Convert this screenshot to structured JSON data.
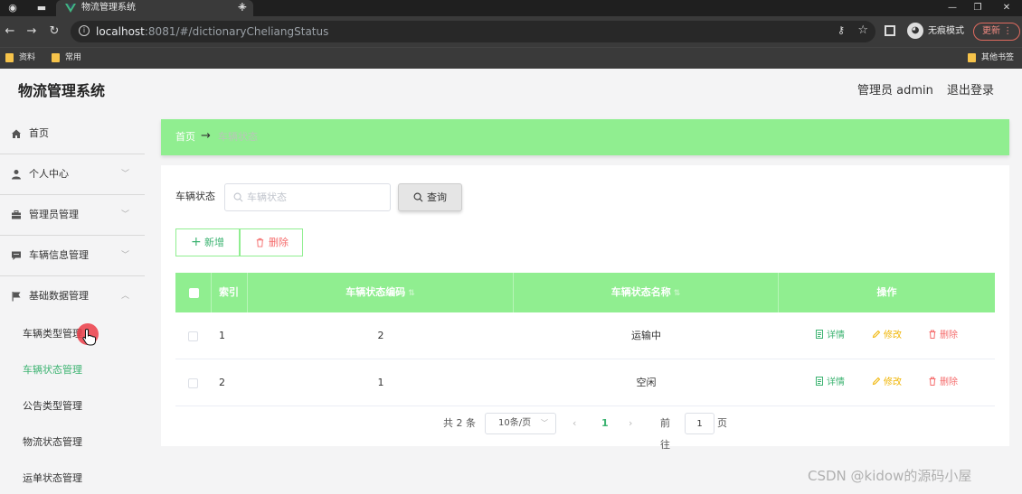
{
  "browser": {
    "tab_title": "物流管理系统",
    "url_host": "localhost",
    "url_rest": ":8081/#/dictionaryCheliangStatus",
    "incognito_label": "无痕模式",
    "update_label": "更新",
    "bookmarks": [
      "资料",
      "常用"
    ],
    "other_bookmarks": "其他书签"
  },
  "header": {
    "title": "物流管理系统",
    "admin_label": "管理员 admin",
    "logout_label": "退出登录"
  },
  "sidebar": {
    "items": [
      {
        "label": "首页"
      },
      {
        "label": "个人中心"
      },
      {
        "label": "管理员管理"
      },
      {
        "label": "车辆信息管理"
      },
      {
        "label": "基础数据管理"
      }
    ],
    "sub_items": [
      {
        "label": "车辆类型管理"
      },
      {
        "label": "车辆状态管理"
      },
      {
        "label": "公告类型管理"
      },
      {
        "label": "物流状态管理"
      },
      {
        "label": "运单状态管理"
      }
    ]
  },
  "breadcrumb": {
    "home": "首页",
    "separator": "→",
    "current": "车辆状态"
  },
  "search": {
    "label": "车辆状态",
    "placeholder": "车辆状态",
    "button_label": "查询"
  },
  "toolbar": {
    "add_label": "新增",
    "delete_label": "删除"
  },
  "table": {
    "headers": {
      "index": "索引",
      "code": "车辆状态编码",
      "name": "车辆状态名称",
      "ops": "操作"
    },
    "rows": [
      {
        "index": "1",
        "code": "2",
        "name": "运输中"
      },
      {
        "index": "2",
        "code": "1",
        "name": "空闲"
      }
    ],
    "actions": {
      "detail": "详情",
      "edit": "修改",
      "remove": "删除"
    }
  },
  "pagination": {
    "total": "共 2 条",
    "page_size": "10条/页",
    "current_page": "1",
    "goto_label": "前往",
    "goto_value": "1",
    "page_suffix": "页"
  },
  "watermark": "CSDN @kidow的源码小屋",
  "colors": {
    "accent": "#90ee90",
    "accent_text": "#3cb371",
    "danger": "#f56c6c",
    "warning": "#f0b400"
  }
}
